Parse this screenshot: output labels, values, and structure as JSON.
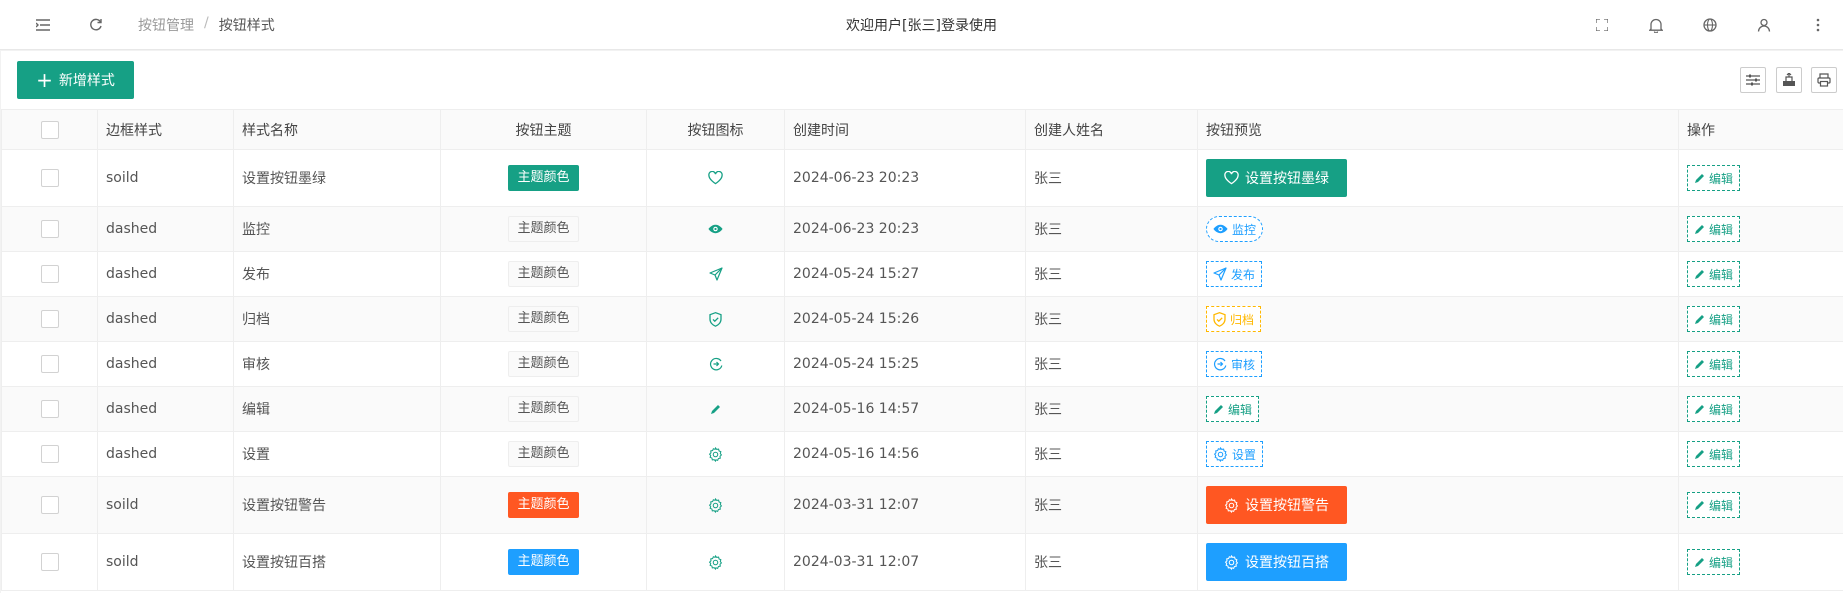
{
  "header": {
    "breadcrumb": [
      "按钮管理",
      "按钮样式"
    ],
    "breadcrumb_sep": "/",
    "welcome": "欢迎用户[张三]登录使用"
  },
  "toolbar": {
    "add_label": "新增样式"
  },
  "table": {
    "columns": [
      "边框样式",
      "样式名称",
      "按钮主题",
      "按钮图标",
      "创建时间",
      "创建人姓名",
      "按钮预览",
      "操作"
    ],
    "rows": [
      {
        "border": "soild",
        "name": "设置按钮墨绿",
        "theme": "主题颜色",
        "theme_color": "#16a085",
        "icon": "heart-icon",
        "time": "2024-06-23 20:23",
        "creator": "张三",
        "preview": "设置按钮墨绿",
        "preview_style": "big",
        "preview_color": "#16a085",
        "action": "编辑"
      },
      {
        "border": "dashed",
        "name": "监控",
        "theme": "主题颜色",
        "theme_color": "",
        "icon": "eye-icon",
        "time": "2024-06-23 20:23",
        "creator": "张三",
        "preview": "监控",
        "preview_style": "small-round",
        "preview_color": "#1e9fff",
        "action": "编辑"
      },
      {
        "border": "dashed",
        "name": "发布",
        "theme": "主题颜色",
        "theme_color": "",
        "icon": "send-icon",
        "time": "2024-05-24 15:27",
        "creator": "张三",
        "preview": "发布",
        "preview_style": "small",
        "preview_color": "#1e9fff",
        "action": "编辑"
      },
      {
        "border": "dashed",
        "name": "归档",
        "theme": "主题颜色",
        "theme_color": "",
        "icon": "shield-check-icon",
        "time": "2024-05-24 15:26",
        "creator": "张三",
        "preview": "归档",
        "preview_style": "small",
        "preview_color": "#ffb800",
        "action": "编辑"
      },
      {
        "border": "dashed",
        "name": "审核",
        "theme": "主题颜色",
        "theme_color": "",
        "icon": "circle-arrow-icon",
        "time": "2024-05-24 15:25",
        "creator": "张三",
        "preview": "审核",
        "preview_style": "small",
        "preview_color": "#1e9fff",
        "action": "编辑"
      },
      {
        "border": "dashed",
        "name": "编辑",
        "theme": "主题颜色",
        "theme_color": "",
        "icon": "pencil-icon",
        "time": "2024-05-16 14:57",
        "creator": "张三",
        "preview": "编辑",
        "preview_style": "small",
        "preview_color": "#16a085",
        "action": "编辑"
      },
      {
        "border": "dashed",
        "name": "设置",
        "theme": "主题颜色",
        "theme_color": "",
        "icon": "gear-icon",
        "time": "2024-05-16 14:56",
        "creator": "张三",
        "preview": "设置",
        "preview_style": "small",
        "preview_color": "#1e9fff",
        "action": "编辑"
      },
      {
        "border": "soild",
        "name": "设置按钮警告",
        "theme": "主题颜色",
        "theme_color": "#ff5722",
        "icon": "gear-icon",
        "time": "2024-03-31 12:07",
        "creator": "张三",
        "preview": "设置按钮警告",
        "preview_style": "big",
        "preview_color": "#ff5722",
        "action": "编辑"
      },
      {
        "border": "soild",
        "name": "设置按钮百搭",
        "theme": "主题颜色",
        "theme_color": "#1e9fff",
        "icon": "gear-icon",
        "time": "2024-03-31 12:07",
        "creator": "张三",
        "preview": "设置按钮百搭",
        "preview_style": "big",
        "preview_color": "#1e9fff",
        "action": "编辑"
      }
    ]
  },
  "colors": {
    "primary": "#16a085",
    "warm": "#ff5722",
    "normal": "#1e9fff",
    "warn": "#ffb800"
  }
}
